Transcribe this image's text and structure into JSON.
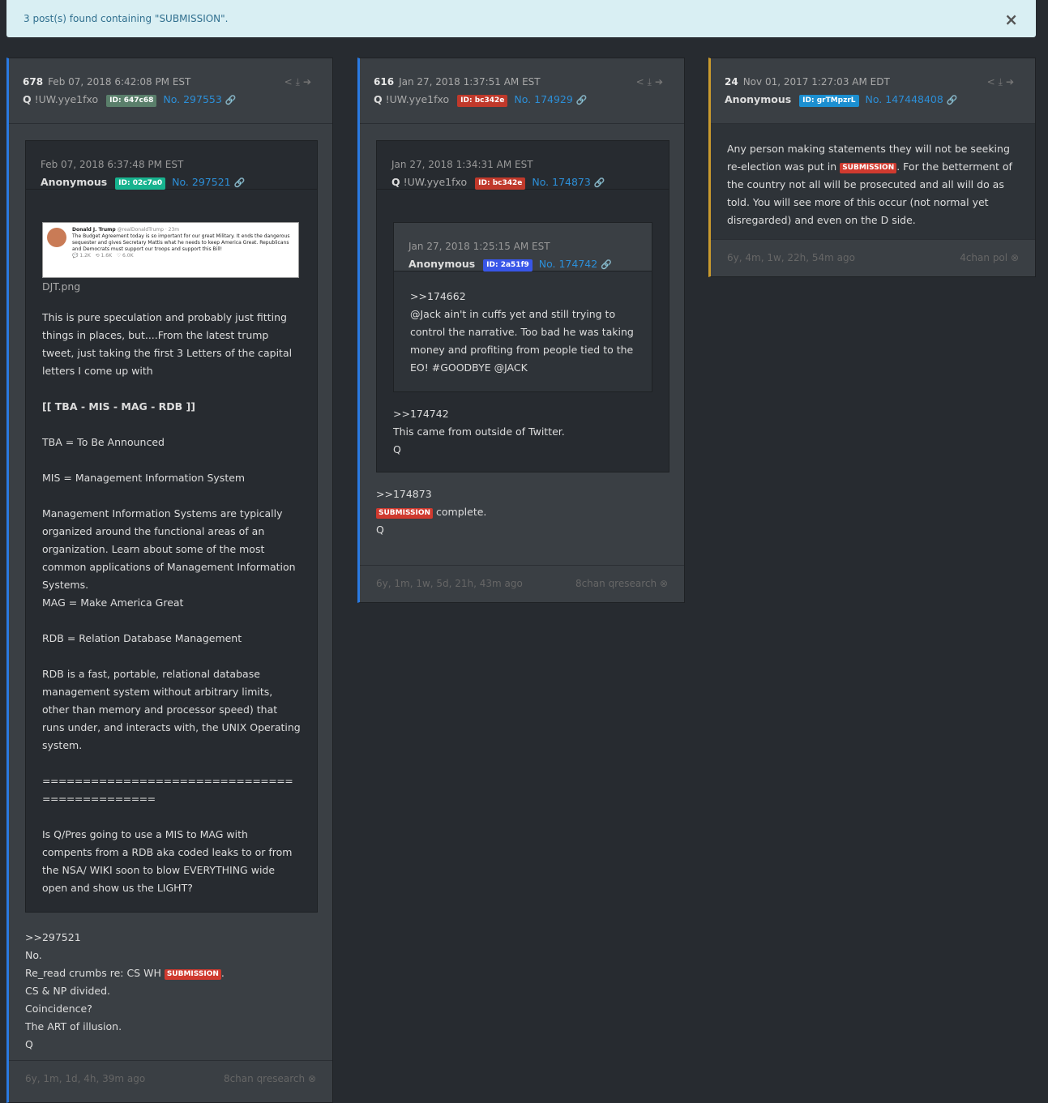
{
  "alert": {
    "message": "3 post(s) found containing \"SUBMISSION\".",
    "close": "×"
  },
  "icons": {
    "actions": "share-icon, download-icon, arrow-right-icon",
    "link": "link-icon",
    "close": "close-circle-icon"
  },
  "colors": {
    "id_647c68": "#5a7f6b",
    "id_bc342e": "#c0392b",
    "id_02c7a0": "#17b38f",
    "id_2a51f9": "#3856e8",
    "id_grTMpzrL": "#1b8fd1",
    "highlight": "#d03a2f"
  },
  "cards": [
    {
      "num": "678",
      "date": "Feb 07, 2018 6:42:08 PM EST",
      "name": "Q",
      "trip": "!UW.yye1fxo",
      "id": "ID: 647c68",
      "postno": "No. 297553",
      "quote": {
        "date": "Feb 07, 2018 6:37:48 PM EST",
        "name": "Anonymous",
        "id": "ID: 02c7a0",
        "postno": "No. 297521",
        "image_name": "DJT.png",
        "tweet": {
          "author": "Donald J. Trump",
          "handle": "@realDonaldTrump · 23m",
          "text": "The Budget Agreement today is so important for our great Military. It ends the dangerous sequester and gives Secretary Mattis what he needs to keep America Great. Republicans and Democrats must support our troops and support this Bill!",
          "stats": [
            "1.2K",
            "1.6K",
            "6.0K"
          ]
        },
        "lines": [
          "This is pure speculation and probably just fitting things in places, but....From the latest trump tweet, just taking the first 3 Letters of the capital letters I come up with",
          "[[ TBA - MIS - MAG - RDB ]]",
          "TBA = To Be Announced",
          "MIS = Management Information System",
          "Management Information Systems are typically organized around the functional areas of an organization. Learn about some of the most common applications of Management Information Systems.",
          "MAG = Make America Great",
          "RDB = Relation Database Management",
          "RDB is a fast, portable, relational database management system without arbitrary limits, other than memory and processor speed) that runs under, and interacts with, the UNIX Operating system.",
          "=============================================",
          "Is Q/Pres going to use a MIS to MAG with compents from a RDB aka coded leaks to or from the NSA/ WIKI soon to blow EVERYTHING wide open and show us the LIGHT?"
        ]
      },
      "reply": {
        "ref": ">>297521",
        "l1": "No.",
        "l2a": "Re_read crumbs re: CS WH ",
        "hl": "SUBMISSION",
        "l2b": ".",
        "l3": "CS & NP divided.",
        "l4": "Coincidence?",
        "l5": "The ART of illusion.",
        "l6": "Q"
      },
      "age": "6y, 1m, 1d, 4h, 39m ago",
      "source": "8chan qresearch"
    },
    {
      "num": "616",
      "date": "Jan 27, 2018 1:37:51 AM EST",
      "name": "Q",
      "trip": "!UW.yye1fxo",
      "id": "ID: bc342e",
      "postno": "No. 174929",
      "quote": {
        "date": "Jan 27, 2018 1:34:31 AM EST",
        "name": "Q",
        "trip": "!UW.yye1fxo",
        "id": "ID: bc342e",
        "postno": "No. 174873",
        "inner": {
          "date": "Jan 27, 2018 1:25:15 AM EST",
          "name": "Anonymous",
          "id": "ID: 2a51f9",
          "postno": "No. 174742",
          "l1": ">>174662",
          "l2": "@Jack ain't in cuffs yet and still trying to control the narrative. Too bad he was taking money and profiting from people tied to the EO! #GOODBYE @JACK"
        },
        "l1": ">>174742",
        "l2": "This came from outside of Twitter.",
        "l3": "Q"
      },
      "reply": {
        "ref": ">>174873",
        "hl": "SUBMISSION",
        "tail": " complete.",
        "sig": "Q"
      },
      "age": "6y, 1m, 1w, 5d, 21h, 43m ago",
      "source": "8chan qresearch"
    },
    {
      "num": "24",
      "date": "Nov 01, 2017 1:27:03 AM EDT",
      "name": "Anonymous",
      "id": "ID: grTMpzrL",
      "postno": "No. 147448408",
      "text_a": "Any person making statements they will not be seeking re-election was put in ",
      "hl": "SUBMISSION",
      "text_b": ". For the betterment of the country not all will be prosecuted and all will do as told. You will see more of this occur (not normal yet disregarded) and even on the D side.",
      "age": "6y, 4m, 1w, 22h, 54m ago",
      "source": "4chan pol"
    }
  ]
}
